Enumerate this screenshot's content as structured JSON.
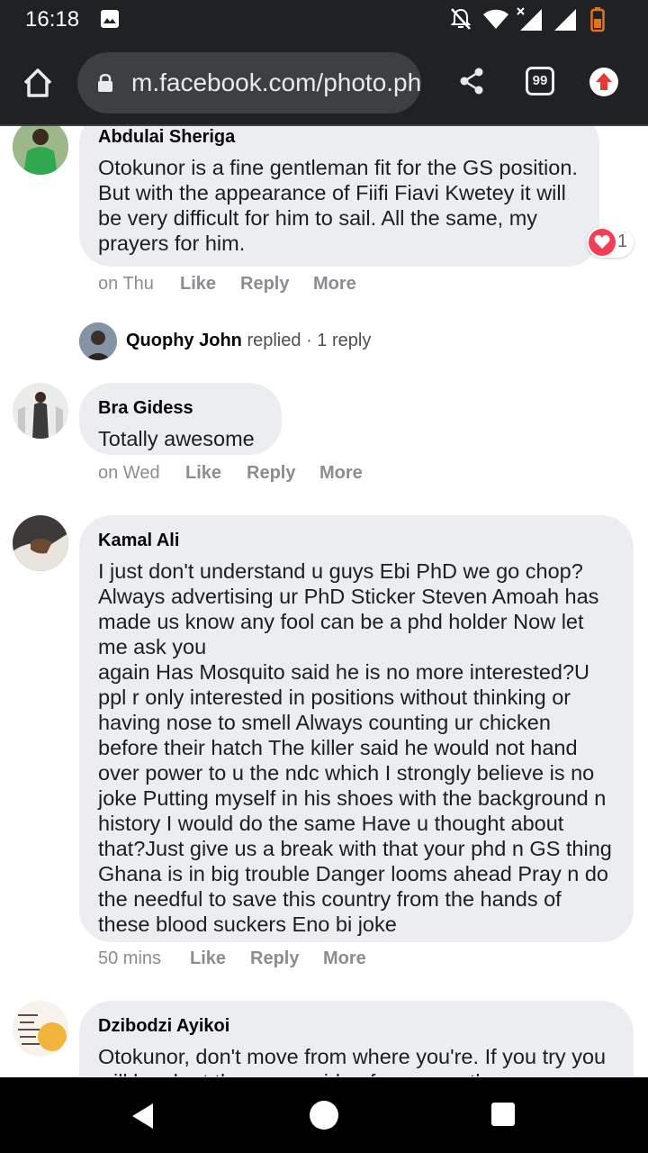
{
  "status_bar": {
    "time": "16:18"
  },
  "browser": {
    "url": "m.facebook.com/photo.php?fbid=",
    "tab_count": "99"
  },
  "comments": [
    {
      "author": "Abdulai Sheriga",
      "text": "Otokunor is a fine gentleman fit for the GS position. But with the appearance of Fiifi Fiavi Kwetey it will be very difficult for him to sail. All the same, my prayers for him.",
      "time": "on Thu",
      "like": "Like",
      "reply": "Reply",
      "more": "More",
      "reaction_count": "1"
    },
    {
      "author": "Bra Gidess",
      "text": "Totally awesome",
      "time": "on Wed",
      "like": "Like",
      "reply": "Reply",
      "more": "More"
    },
    {
      "author": "Kamal Ali",
      "text": "I just don't understand u guys Ebi PhD we go chop? Always advertising ur PhD Sticker Steven Amoah has made us know any fool can be a phd holder Now let me ask you\nagain Has Mosquito said he is no more interested?U ppl r only interested in positions without thinking or having nose to smell Always counting ur chicken before their hatch The killer said he would not hand over power to u the ndc which I strongly believe is no joke Putting myself in his shoes with the background n history I would do the same Have u thought about that?Just give us a break with that your phd n GS thing Ghana is in big trouble Danger looms ahead Pray n do the needful to save this country from the hands of these blood suckers Eno bi joke",
      "time": "50 mins",
      "like": "Like",
      "reply": "Reply",
      "more": "More"
    },
    {
      "author": "Dzibodzi Ayikoi",
      "text": "Otokunor, don't move from where you're. If you try you will laugh at the wrong side of your mouth."
    }
  ],
  "reply_summary": {
    "name": "Quophy John",
    "verb": "replied",
    "separator": "·",
    "count": "1 reply"
  },
  "colors": {
    "bubble": "#ebedf0",
    "chrome_bar": "#202124",
    "reaction_heart": "#f33e58",
    "update_arrow": "#e53935"
  }
}
